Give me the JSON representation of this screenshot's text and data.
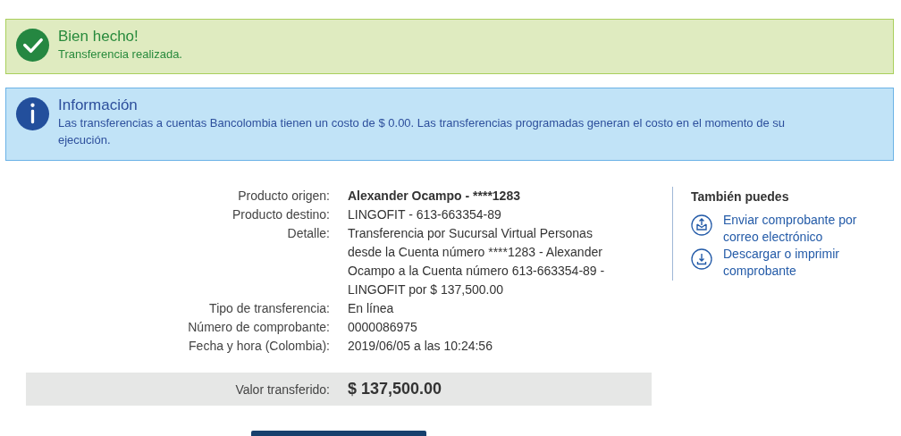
{
  "alerts": [
    {
      "kind": "success",
      "title": "Bien hecho!",
      "message": "Transferencia realizada."
    },
    {
      "kind": "info",
      "title": "Información",
      "message": "Las transferencias a cuentas Bancolombia tienen un costo de $ 0.00. Las transferencias programadas generan el costo en el momento de su ejecución."
    }
  ],
  "details": [
    {
      "label": "Producto origen:",
      "value": "Alexander Ocampo - ****1283",
      "bold": true
    },
    {
      "label": "Producto destino:",
      "value": "LINGOFIT - 613-663354-89",
      "bold": false
    },
    {
      "label": "Detalle:",
      "value": "Transferencia por Sucursal Virtual Personas desde la Cuenta número ****1283 - Alexander Ocampo a la Cuenta número 613-663354-89 - LINGOFIT por $ 137,500.00",
      "bold": false
    },
    {
      "label": "Tipo de transferencia:",
      "value": "En línea",
      "bold": false
    },
    {
      "label": "Número de comprobante:",
      "value": "0000086975",
      "bold": false
    },
    {
      "label": "Fecha y hora (Colombia):",
      "value": "2019/06/05 a las 10:24:56",
      "bold": false
    }
  ],
  "total": {
    "label": "Valor transferido:",
    "value": "$ 137,500.00"
  },
  "side_panel": {
    "title": "También puedes",
    "actions": [
      {
        "kind": "email",
        "label": "Enviar comprobante por correo electrónico"
      },
      {
        "kind": "download",
        "label": "Descargar o imprimir comprobante"
      }
    ]
  }
}
